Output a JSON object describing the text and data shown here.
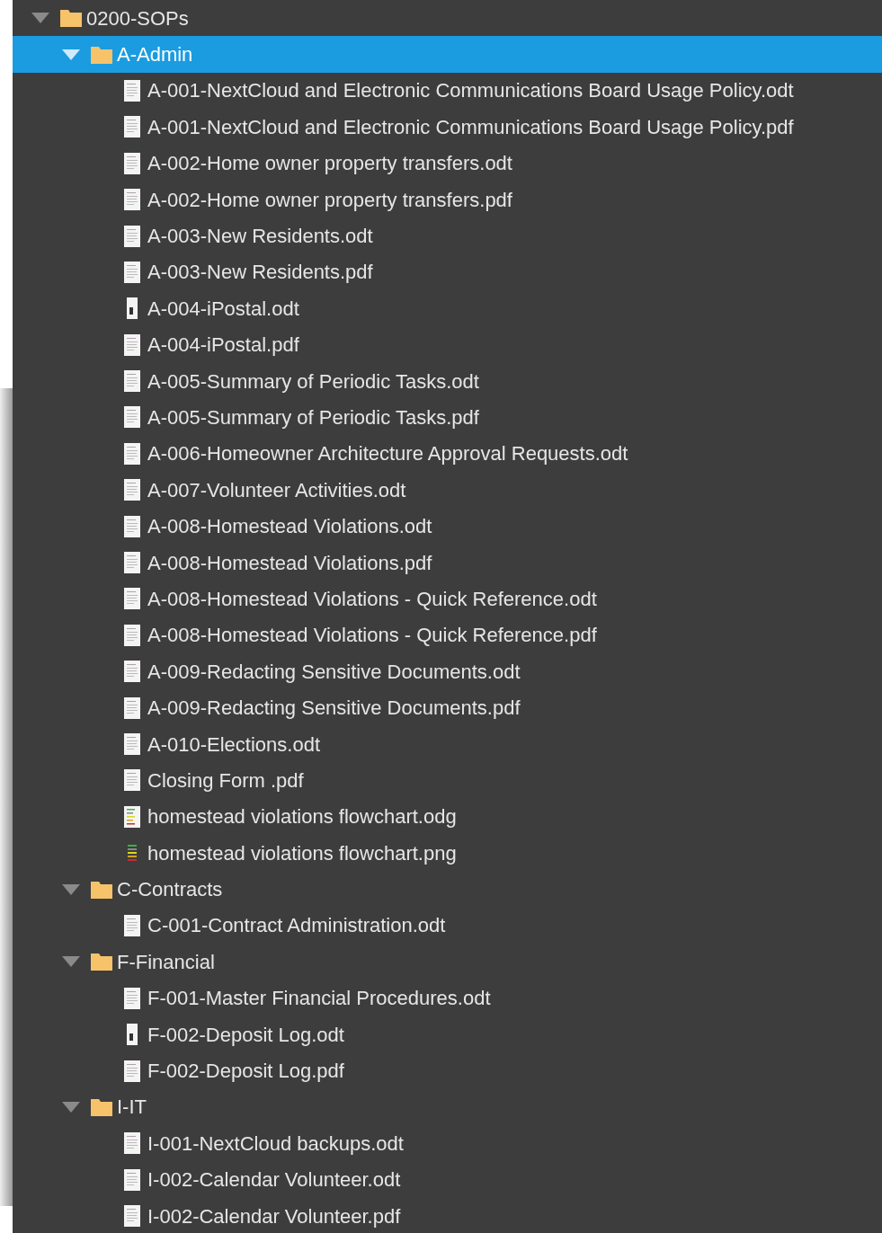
{
  "tree": {
    "name": "0200-SOPs",
    "expanded": true,
    "selected": false,
    "children": [
      {
        "name": "A-Admin",
        "expanded": true,
        "selected": true,
        "children": [
          {
            "name": "A-001-NextCloud and Electronic Communications Board Usage Policy.odt",
            "kind": "document",
            "selected": false
          },
          {
            "name": "A-001-NextCloud and Electronic Communications Board Usage Policy.pdf",
            "kind": "document",
            "selected": false
          },
          {
            "name": "A-002-Home owner property transfers.odt",
            "kind": "document",
            "selected": false
          },
          {
            "name": "A-002-Home owner property transfers.pdf",
            "kind": "document",
            "selected": false
          },
          {
            "name": "A-003-New Residents.odt",
            "kind": "document",
            "selected": false
          },
          {
            "name": "A-003-New Residents.pdf",
            "kind": "document",
            "selected": false
          },
          {
            "name": "A-004-iPostal.odt",
            "kind": "narrow",
            "selected": false
          },
          {
            "name": "A-004-iPostal.pdf",
            "kind": "document",
            "selected": false
          },
          {
            "name": "A-005-Summary of Periodic Tasks.odt",
            "kind": "document",
            "selected": false
          },
          {
            "name": "A-005-Summary of Periodic Tasks.pdf",
            "kind": "document",
            "selected": false
          },
          {
            "name": "A-006-Homeowner Architecture Approval Requests.odt",
            "kind": "document",
            "selected": false
          },
          {
            "name": "A-007-Volunteer Activities.odt",
            "kind": "document",
            "selected": false
          },
          {
            "name": "A-008-Homestead Violations.odt",
            "kind": "document",
            "selected": false
          },
          {
            "name": "A-008-Homestead Violations.pdf",
            "kind": "document",
            "selected": false
          },
          {
            "name": "A-008-Homestead Violations - Quick Reference.odt",
            "kind": "document",
            "selected": false
          },
          {
            "name": "A-008-Homestead Violations - Quick Reference.pdf",
            "kind": "document",
            "selected": false
          },
          {
            "name": "A-009-Redacting Sensitive Documents.odt",
            "kind": "document",
            "selected": false
          },
          {
            "name": "A-009-Redacting Sensitive Documents.pdf",
            "kind": "document",
            "selected": false
          },
          {
            "name": "A-010-Elections.odt",
            "kind": "document",
            "selected": false
          },
          {
            "name": "Closing Form .pdf",
            "kind": "document",
            "selected": false
          },
          {
            "name": "homestead violations flowchart.odg",
            "kind": "diagram",
            "selected": false
          },
          {
            "name": "homestead violations flowchart.png",
            "kind": "image",
            "selected": false
          }
        ]
      },
      {
        "name": "C-Contracts",
        "expanded": true,
        "selected": false,
        "children": [
          {
            "name": "C-001-Contract Administration.odt",
            "kind": "document",
            "selected": false
          }
        ]
      },
      {
        "name": "F-Financial",
        "expanded": true,
        "selected": false,
        "children": [
          {
            "name": "F-001-Master Financial Procedures.odt",
            "kind": "document",
            "selected": false
          },
          {
            "name": "F-002-Deposit Log.odt",
            "kind": "narrow",
            "selected": false
          },
          {
            "name": "F-002-Deposit Log.pdf",
            "kind": "document",
            "selected": false
          }
        ]
      },
      {
        "name": "I-IT",
        "expanded": true,
        "selected": false,
        "children": [
          {
            "name": "I-001-NextCloud backups.odt",
            "kind": "document",
            "selected": false
          },
          {
            "name": "I-002-Calendar Volunteer.odt",
            "kind": "document",
            "selected": false
          },
          {
            "name": "I-002-Calendar Volunteer.pdf",
            "kind": "document",
            "selected": false
          }
        ]
      }
    ]
  }
}
